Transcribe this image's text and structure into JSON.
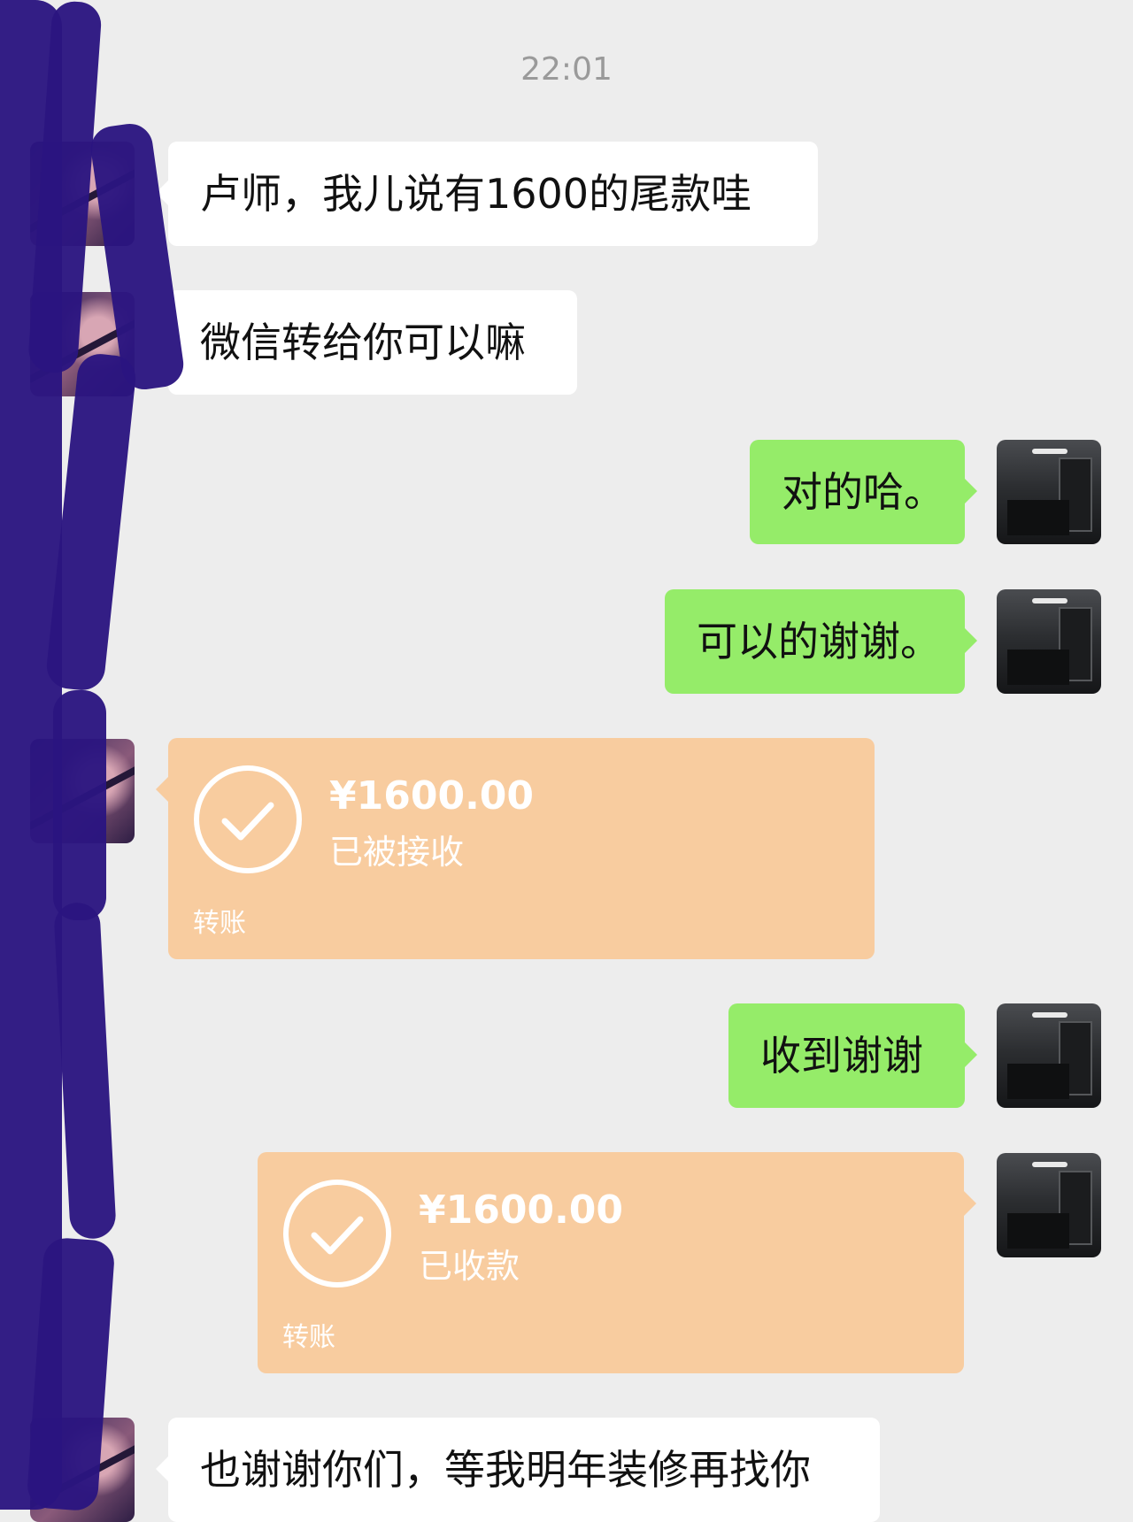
{
  "chat": {
    "timestamp": "22:01",
    "messages": [
      {
        "text": "卢师，我儿说有1600的尾款哇"
      },
      {
        "text": "微信转给你可以嘛"
      },
      {
        "text": "对的哈。"
      },
      {
        "text": "可以的谢谢。"
      },
      {
        "amount": "¥1600.00",
        "status": "已被接收",
        "label": "转账"
      },
      {
        "text": "收到谢谢"
      },
      {
        "amount": "¥1600.00",
        "status": "已收款",
        "label": "转账"
      },
      {
        "text": "也谢谢你们，等我明年装修再找你"
      }
    ]
  },
  "colors": {
    "background": "#ededed",
    "sent_bubble": "#95ec69",
    "received_bubble": "#ffffff",
    "transfer_card": "#f8cc9f",
    "redaction": "#2b1580"
  },
  "icons": {
    "transfer_status": "check-circle-icon"
  }
}
